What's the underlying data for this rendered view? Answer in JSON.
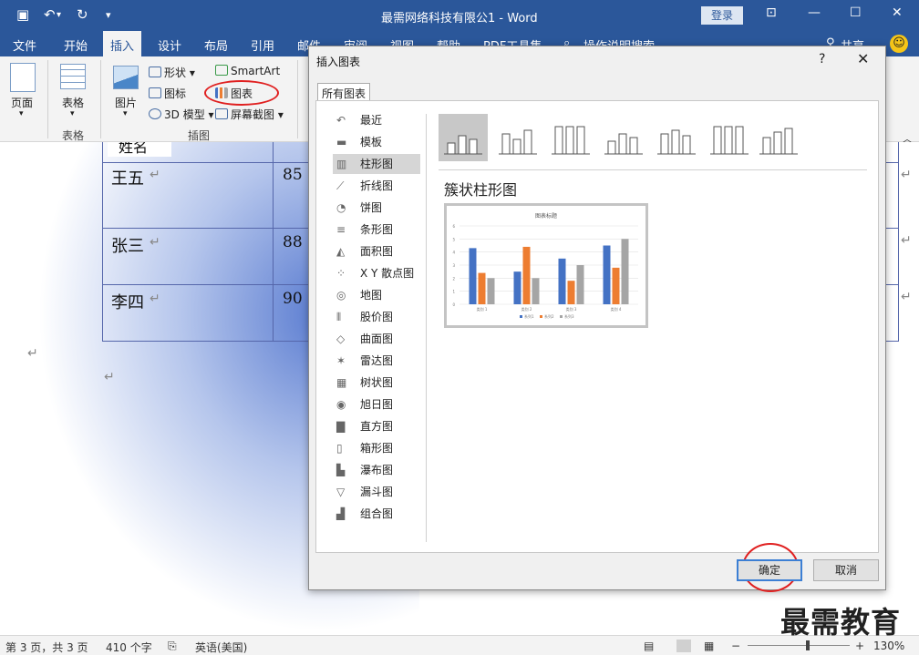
{
  "window": {
    "title": "最需网络科技有限公1 - Word",
    "login": "登录"
  },
  "tabs": [
    "文件",
    "开始",
    "插入",
    "设计",
    "布局",
    "引用",
    "邮件",
    "审阅",
    "视图",
    "帮助",
    "PDF工具集",
    "操作说明搜索"
  ],
  "share": "共享",
  "ribbon": {
    "page_label": "页面",
    "table_label": "表格",
    "table_group": "表格",
    "picture_label": "图片",
    "shapes": "形状",
    "icons": "图标",
    "model3d": "3D 模型",
    "smartart": "SmartArt",
    "chart": "图表",
    "screenshot": "屏幕截图",
    "illustration_group": "插图"
  },
  "document": {
    "header_fragment": "姓名",
    "rows": [
      {
        "name": "王五",
        "score": "85"
      },
      {
        "name": "张三",
        "score": "88"
      },
      {
        "name": "李四",
        "score": "90"
      }
    ],
    "para_mark": "↵"
  },
  "dialog": {
    "title": "插入图表",
    "help": "?",
    "close": "✕",
    "tab": "所有图表",
    "categories": [
      "最近",
      "模板",
      "柱形图",
      "折线图",
      "饼图",
      "条形图",
      "面积图",
      "X Y 散点图",
      "地图",
      "股价图",
      "曲面图",
      "雷达图",
      "树状图",
      "旭日图",
      "直方图",
      "箱形图",
      "瀑布图",
      "漏斗图",
      "组合图"
    ],
    "selected_category": "柱形图",
    "subtype_name": "簇状柱形图",
    "ok": "确定",
    "cancel": "取消"
  },
  "preview_chart": {
    "title": "图表标题",
    "categories": [
      "类别 1",
      "类别 2",
      "类别 3",
      "类别 4"
    ],
    "ticks": [
      "0",
      "1",
      "2",
      "3",
      "4",
      "5",
      "6"
    ],
    "legend": [
      "系列1",
      "系列2",
      "系列3"
    ],
    "colors": [
      "#4472c4",
      "#ed7d31",
      "#a5a5a5"
    ]
  },
  "chart_data": {
    "type": "bar",
    "title": "图表标题",
    "categories": [
      "类别 1",
      "类别 2",
      "类别 3",
      "类别 4"
    ],
    "series": [
      {
        "name": "系列1",
        "values": [
          4.3,
          2.5,
          3.5,
          4.5
        ]
      },
      {
        "name": "系列2",
        "values": [
          2.4,
          4.4,
          1.8,
          2.8
        ]
      },
      {
        "name": "系列3",
        "values": [
          2,
          2,
          3,
          5
        ]
      }
    ],
    "ylim": [
      0,
      6
    ],
    "legend": "bottom"
  },
  "status": {
    "page": "第 3 页，共 3 页",
    "words": "410 个字",
    "lang": "英语(美国)",
    "zoom": "130%"
  },
  "watermark": "最需教育"
}
